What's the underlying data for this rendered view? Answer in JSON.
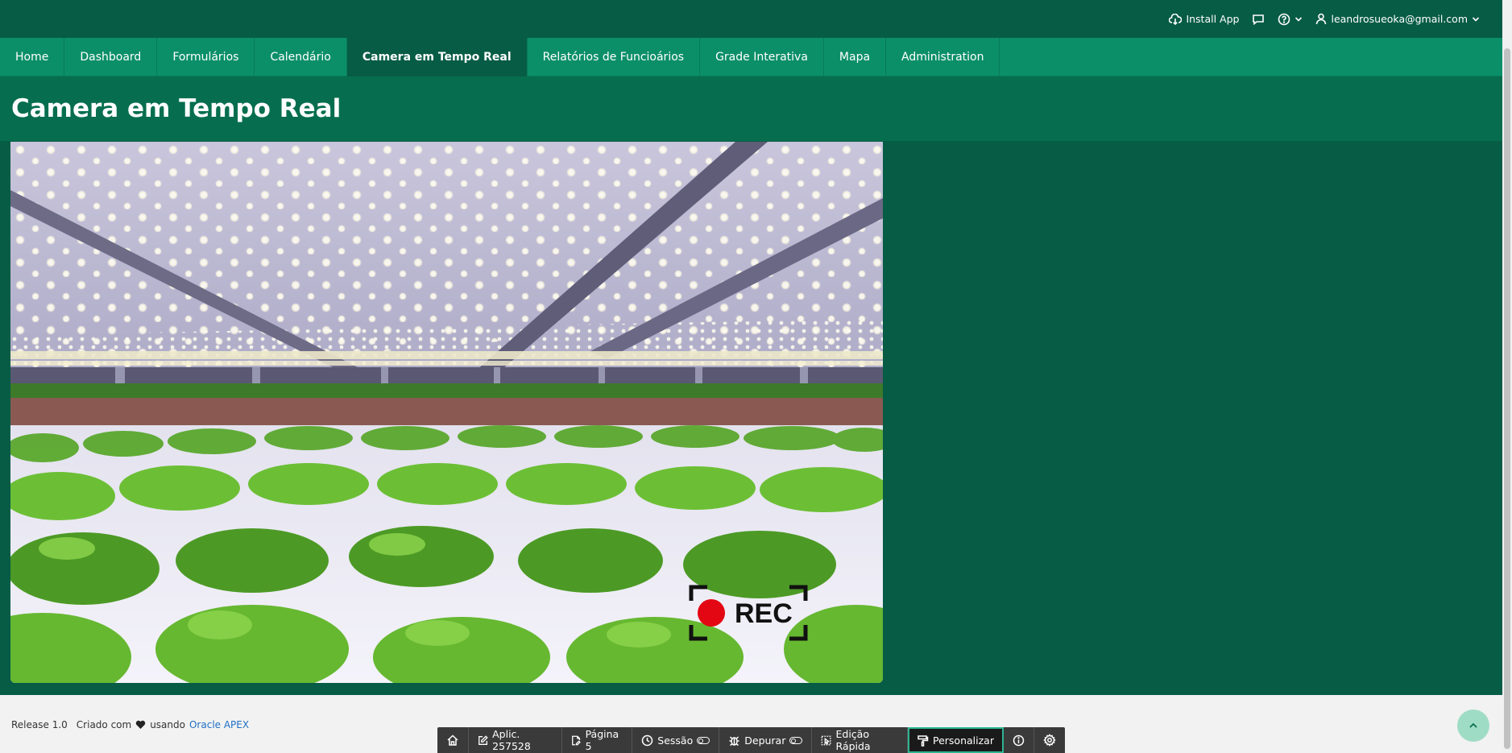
{
  "header": {
    "install_label": "Install App",
    "user_email": "leandrosueoka@gmail.com",
    "icons": [
      "cloud-download-icon",
      "chat-icon",
      "help-icon",
      "user-icon"
    ]
  },
  "nav": {
    "items": [
      "Home",
      "Dashboard",
      "Formulários",
      "Calendário",
      "Camera em Tempo Real",
      "Relatórios de Funcioários",
      "Grade Interativa",
      "Mapa",
      "Administration"
    ],
    "active_index": 4
  },
  "page": {
    "title": "Camera em Tempo Real"
  },
  "camera": {
    "rec_label": "REC",
    "rec_color": "#e30613"
  },
  "footer": {
    "release": "Release 1.0",
    "created_with": "Criado com",
    "using": "usando",
    "apex_link": "Oracle APEX"
  },
  "devbar": {
    "app": "Aplic. 257528",
    "page": "Página 5",
    "session": "Sessão",
    "debug": "Depurar",
    "quick_edit": "Edição Rápida",
    "customize": "Personalizar"
  },
  "colors": {
    "header": "#075c46",
    "nav": "#0b8f69",
    "nav_active": "#075c46",
    "title_bar": "#066e4f",
    "content": "#075c46",
    "accent": "#2cb590"
  }
}
